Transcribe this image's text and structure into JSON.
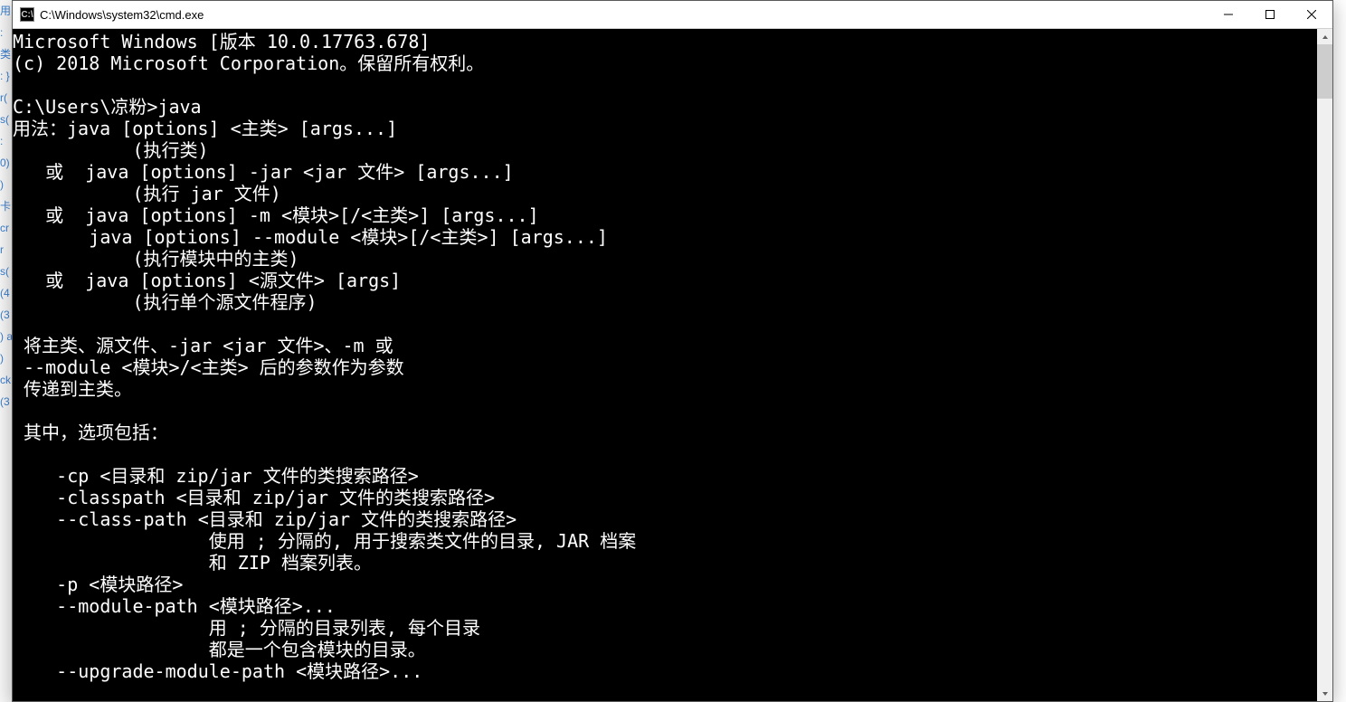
{
  "window": {
    "title": "C:\\Windows\\system32\\cmd.exe",
    "icon_label": "C:\\"
  },
  "backdrop": {
    "left_fragments": "用\n:\n类\n:\n}\nr(\ns(\n:\n0)\n)\n\n卡\ncr\nr\ns(\n(4\n\n\n(3\n)\na\n\n)\nck\n(3"
  },
  "console": {
    "lines": [
      "Microsoft Windows [版本 10.0.17763.678]",
      "(c) 2018 Microsoft Corporation。保留所有权利。",
      "",
      "C:\\Users\\凉粉>java",
      "用法：java [options] <主类> [args...]",
      "           (执行类)",
      "   或  java [options] -jar <jar 文件> [args...]",
      "           (执行 jar 文件)",
      "   或  java [options] -m <模块>[/<主类>] [args...]",
      "       java [options] --module <模块>[/<主类>] [args...]",
      "           (执行模块中的主类)",
      "   或  java [options] <源文件> [args]",
      "           (执行单个源文件程序)",
      "",
      " 将主类、源文件、-jar <jar 文件>、-m 或",
      " --module <模块>/<主类> 后的参数作为参数",
      " 传递到主类。",
      "",
      " 其中，选项包括：",
      "",
      "    -cp <目录和 zip/jar 文件的类搜索路径>",
      "    -classpath <目录和 zip/jar 文件的类搜索路径>",
      "    --class-path <目录和 zip/jar 文件的类搜索路径>",
      "                  使用 ; 分隔的, 用于搜索类文件的目录, JAR 档案",
      "                  和 ZIP 档案列表。",
      "    -p <模块路径>",
      "    --module-path <模块路径>...",
      "                  用 ; 分隔的目录列表, 每个目录",
      "                  都是一个包含模块的目录。",
      "    --upgrade-module-path <模块路径>..."
    ]
  }
}
